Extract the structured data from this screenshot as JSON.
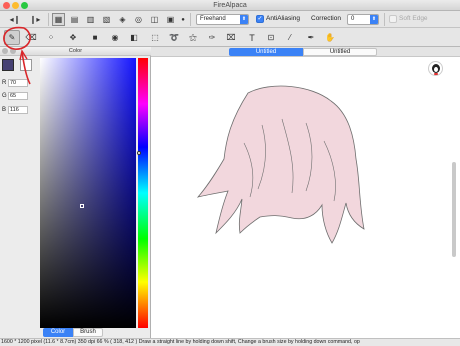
{
  "window": {
    "title": "FireAlpaca"
  },
  "toolbar": {
    "brush_mode": "Freehand",
    "antialiasing_label": "AntiAliasing",
    "correction_label": "Correction",
    "correction_value": "0",
    "soft_edge_label": "Soft Edge"
  },
  "left_panel": {
    "header": "Color",
    "rgb": [
      {
        "label": "R",
        "value": "70"
      },
      {
        "label": "G",
        "value": "65"
      },
      {
        "label": "B",
        "value": "116"
      }
    ],
    "tabs": [
      {
        "label": "Color"
      },
      {
        "label": "Brush"
      }
    ]
  },
  "canvas": {
    "tabs": [
      {
        "label": "Untitled"
      },
      {
        "label": "Untitled"
      }
    ]
  },
  "status": {
    "text": "1600 * 1200 pixel   (11.6 * 8.7cm)   350 dpi   66 %   ( 318, 412 )   Draw a straight line by holding down shift, Change a brush size by holding down command, op"
  },
  "colors": {
    "current_color": "#464174",
    "hair_fill": "#f2d7dd",
    "annotation_red": "#d9262a",
    "accent": "#3b82f6"
  }
}
